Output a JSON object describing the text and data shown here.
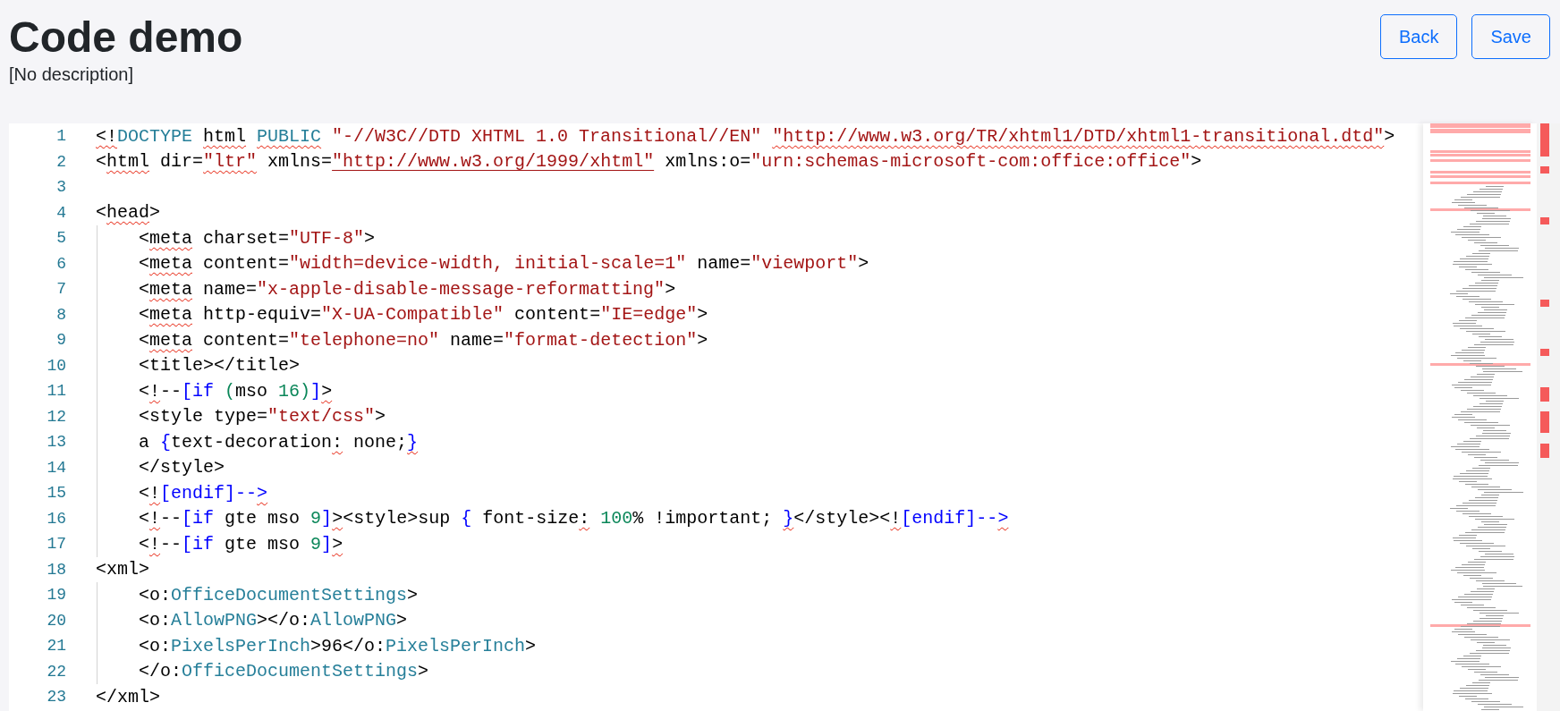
{
  "page": {
    "title": "Code demo",
    "description": "[No description]"
  },
  "buttons": [
    {
      "label": "Back"
    },
    {
      "label": "Save"
    }
  ],
  "editor": {
    "lines": [
      {
        "number": "1",
        "tokens": [
          {
            "text": "<!",
            "kind": "plain",
            "error": true
          },
          {
            "text": "DOCTYPE",
            "kind": "keyword",
            "error": false
          },
          {
            "text": "html",
            "kind": "plain",
            "error": true,
            "space_before": true
          },
          {
            "text": "PUBLIC",
            "kind": "keyword",
            "error": true,
            "space_before": true
          },
          {
            "text": "\"-//W3C//DTD XHTML 1.0 Transitional//EN\"",
            "kind": "string",
            "error": false,
            "space_before": true
          },
          {
            "text": "\"http://www.w3.org/TR/xhtml1/DTD/xhtml1-transitional.dtd\"",
            "kind": "string",
            "error": true,
            "space_before": true
          },
          {
            "text": ">",
            "kind": "plain",
            "error": false
          }
        ]
      },
      {
        "number": "2",
        "tokens": [
          {
            "text": "<",
            "kind": "plain",
            "error": false
          },
          {
            "text": "html",
            "kind": "plain",
            "error": true
          },
          {
            "text": " dir=",
            "kind": "plain",
            "error": false
          },
          {
            "text": "\"ltr\"",
            "kind": "string",
            "error": true
          },
          {
            "text": " xmlns=",
            "kind": "plain",
            "error": false
          },
          {
            "text": "\"http://www.w3.org/1999/xhtml\"",
            "kind": "link",
            "error": false
          },
          {
            "text": " xmlns:o=",
            "kind": "plain",
            "error": false
          },
          {
            "text": "\"urn:schemas-microsoft-com:office:office\"",
            "kind": "string",
            "error": false
          },
          {
            "text": ">",
            "kind": "plain",
            "error": false
          }
        ]
      },
      {
        "number": "3"
      },
      {
        "number": "4",
        "tokens": [
          {
            "text": "<",
            "kind": "plain",
            "error": false
          },
          {
            "text": "head",
            "kind": "plain",
            "error": true
          },
          {
            "text": ">",
            "kind": "plain",
            "error": false
          }
        ],
        "children": [
          {
            "number": "5",
            "tokens": [
              {
                "text": "<",
                "kind": "plain",
                "error": false
              },
              {
                "text": "meta",
                "kind": "plain",
                "error": true
              },
              {
                "text": " charset=",
                "kind": "plain",
                "error": false
              },
              {
                "text": "\"UTF-8\"",
                "kind": "string",
                "error": false
              },
              {
                "text": ">",
                "kind": "plain",
                "error": false
              }
            ]
          },
          {
            "number": "6",
            "tokens": [
              {
                "text": "<",
                "kind": "plain",
                "error": false
              },
              {
                "text": "meta",
                "kind": "plain",
                "error": true
              },
              {
                "text": " content=",
                "kind": "plain",
                "error": false
              },
              {
                "text": "\"width=device-width, initial-scale=1\"",
                "kind": "string",
                "error": false
              },
              {
                "text": " name=",
                "kind": "plain",
                "error": false
              },
              {
                "text": "\"viewport\"",
                "kind": "string",
                "error": false
              },
              {
                "text": ">",
                "kind": "plain",
                "error": false
              }
            ]
          },
          {
            "number": "7",
            "tokens": [
              {
                "text": "<",
                "kind": "plain",
                "error": false
              },
              {
                "text": "meta",
                "kind": "plain",
                "error": true
              },
              {
                "text": " name=",
                "kind": "plain",
                "error": false
              },
              {
                "text": "\"x-apple-disable-message-reformatting\"",
                "kind": "string",
                "error": false
              },
              {
                "text": ">",
                "kind": "plain",
                "error": false
              }
            ]
          },
          {
            "number": "8",
            "tokens": [
              {
                "text": "<",
                "kind": "plain",
                "error": false
              },
              {
                "text": "meta",
                "kind": "plain",
                "error": true
              },
              {
                "text": " http-equiv=",
                "kind": "plain",
                "error": false
              },
              {
                "text": "\"X-UA-Compatible\"",
                "kind": "string",
                "error": false
              },
              {
                "text": " content=",
                "kind": "plain",
                "error": false
              },
              {
                "text": "\"IE=edge\"",
                "kind": "string",
                "error": false
              },
              {
                "text": ">",
                "kind": "plain",
                "error": false
              }
            ]
          },
          {
            "number": "9",
            "tokens": [
              {
                "text": "<",
                "kind": "plain",
                "error": false
              },
              {
                "text": "meta",
                "kind": "plain",
                "error": true
              },
              {
                "text": " content=",
                "kind": "plain",
                "error": false
              },
              {
                "text": "\"telephone=no\"",
                "kind": "string",
                "error": false
              },
              {
                "text": " name=",
                "kind": "plain",
                "error": false
              },
              {
                "text": "\"format-detection\"",
                "kind": "string",
                "error": false
              },
              {
                "text": ">",
                "kind": "plain",
                "error": false
              }
            ]
          },
          {
            "number": "10",
            "tokens": [
              {
                "text": "<title></title>",
                "kind": "plain",
                "error": false
              }
            ]
          },
          {
            "number": "11",
            "tokens": [
              {
                "text": "<",
                "kind": "plain",
                "error": false
              },
              {
                "text": "!",
                "kind": "plain",
                "error": true
              },
              {
                "text": "--",
                "kind": "plain",
                "error": false
              },
              {
                "text": "[if",
                "kind": "bracket",
                "error": false
              },
              {
                "text": "(",
                "kind": "number",
                "error": false,
                "space_before": true
              },
              {
                "text": "mso ",
                "kind": "plain",
                "error": false
              },
              {
                "text": "16)",
                "kind": "number",
                "error": false
              },
              {
                "text": "]",
                "kind": "bracket",
                "error": false
              },
              {
                "text": ">",
                "kind": "plain",
                "error": true
              }
            ]
          },
          {
            "number": "12",
            "tokens": [
              {
                "text": "<style type=",
                "kind": "plain",
                "error": false
              },
              {
                "text": "\"text/css\"",
                "kind": "string",
                "error": false
              },
              {
                "text": ">",
                "kind": "plain",
                "error": false
              }
            ]
          },
          {
            "number": "13",
            "tokens": [
              {
                "text": "a ",
                "kind": "plain",
                "error": false
              },
              {
                "text": "{",
                "kind": "bracket",
                "error": false
              },
              {
                "text": "text-decoration",
                "kind": "plain",
                "error": false
              },
              {
                "text": ":",
                "kind": "plain",
                "error": true
              },
              {
                "text": " none;",
                "kind": "plain",
                "error": false
              },
              {
                "text": "}",
                "kind": "bracket",
                "error": true
              }
            ]
          },
          {
            "number": "14",
            "tokens": [
              {
                "text": "</style>",
                "kind": "plain",
                "error": false
              }
            ]
          },
          {
            "number": "15",
            "tokens": [
              {
                "text": "<",
                "kind": "plain",
                "error": false
              },
              {
                "text": "!",
                "kind": "plain",
                "error": true
              },
              {
                "text": "[endif]--",
                "kind": "bracket",
                "error": false
              },
              {
                "text": ">",
                "kind": "bracket",
                "error": true
              }
            ]
          },
          {
            "number": "16",
            "tokens": [
              {
                "text": "<",
                "kind": "plain",
                "error": false
              },
              {
                "text": "!",
                "kind": "plain",
                "error": true
              },
              {
                "text": "--",
                "kind": "plain",
                "error": false
              },
              {
                "text": "[if",
                "kind": "bracket",
                "error": false
              },
              {
                "text": " gte mso ",
                "kind": "plain",
                "error": false
              },
              {
                "text": "9",
                "kind": "number",
                "error": false
              },
              {
                "text": "]",
                "kind": "bracket",
                "error": false
              },
              {
                "text": ">",
                "kind": "plain",
                "error": true
              },
              {
                "text": "<style>sup ",
                "kind": "plain",
                "error": false
              },
              {
                "text": "{",
                "kind": "bracket",
                "error": false
              },
              {
                "text": " font-size",
                "kind": "plain",
                "error": false
              },
              {
                "text": ":",
                "kind": "plain",
                "error": true
              },
              {
                "text": "100",
                "kind": "number",
                "error": false,
                "space_before": true
              },
              {
                "text": "% !important; ",
                "kind": "plain",
                "error": false
              },
              {
                "text": "}",
                "kind": "bracket",
                "error": true
              },
              {
                "text": "</style><",
                "kind": "plain",
                "error": false
              },
              {
                "text": "!",
                "kind": "plain",
                "error": true
              },
              {
                "text": "[endif]--",
                "kind": "bracket",
                "error": false
              },
              {
                "text": ">",
                "kind": "bracket",
                "error": true
              }
            ]
          },
          {
            "number": "17",
            "tokens": [
              {
                "text": "<",
                "kind": "plain",
                "error": false
              },
              {
                "text": "!",
                "kind": "plain",
                "error": true
              },
              {
                "text": "--",
                "kind": "plain",
                "error": false
              },
              {
                "text": "[if",
                "kind": "bracket",
                "error": false
              },
              {
                "text": " gte mso ",
                "kind": "plain",
                "error": false
              },
              {
                "text": "9",
                "kind": "number",
                "error": false
              },
              {
                "text": "]",
                "kind": "bracket",
                "error": false
              },
              {
                "text": ">",
                "kind": "plain",
                "error": true
              }
            ]
          }
        ]
      },
      {
        "number": "18",
        "tokens": [
          {
            "text": "<xml>",
            "kind": "plain",
            "error": false
          }
        ],
        "children": [
          {
            "number": "19",
            "tokens": [
              {
                "text": "<o:",
                "kind": "plain",
                "error": false
              },
              {
                "text": "OfficeDocumentSettings",
                "kind": "keyword",
                "error": false
              },
              {
                "text": ">",
                "kind": "plain",
                "error": false
              }
            ]
          },
          {
            "number": "20",
            "tokens": [
              {
                "text": "<o:",
                "kind": "plain",
                "error": false
              },
              {
                "text": "AllowPNG",
                "kind": "keyword",
                "error": false
              },
              {
                "text": "></o:",
                "kind": "plain",
                "error": false
              },
              {
                "text": "AllowPNG",
                "kind": "keyword",
                "error": false
              },
              {
                "text": ">",
                "kind": "plain",
                "error": false
              }
            ]
          },
          {
            "number": "21",
            "tokens": [
              {
                "text": "<o:",
                "kind": "plain",
                "error": false
              },
              {
                "text": "PixelsPerInch",
                "kind": "keyword",
                "error": false
              },
              {
                "text": ">96</o:",
                "kind": "plain",
                "error": false
              },
              {
                "text": "PixelsPerInch",
                "kind": "keyword",
                "error": false
              },
              {
                "text": ">",
                "kind": "plain",
                "error": false
              }
            ]
          },
          {
            "number": "22",
            "tokens": [
              {
                "text": "</o:",
                "kind": "plain",
                "error": false
              },
              {
                "text": "OfficeDocumentSettings",
                "kind": "keyword",
                "error": false
              },
              {
                "text": ">",
                "kind": "plain",
                "error": false
              }
            ]
          }
        ]
      },
      {
        "number": "23",
        "tokens": [
          {
            "text": "</xml>",
            "kind": "plain",
            "error": false
          }
        ]
      }
    ]
  }
}
